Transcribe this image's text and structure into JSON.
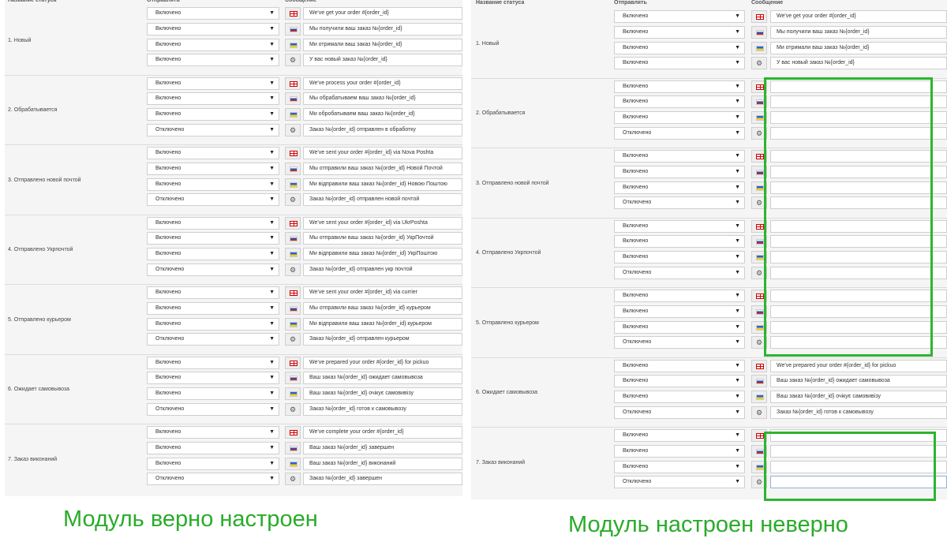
{
  "headers": {
    "status": "Название статуса",
    "send": "Отправлять",
    "message": "Сообщение"
  },
  "options": {
    "on": "Включено",
    "off": "Отключено"
  },
  "statuses": [
    {
      "name": "1. Новый",
      "send": [
        "Включено",
        "Включено",
        "Включено",
        "Включено"
      ],
      "messages": [
        "We've get your order #{order_id}",
        "Мы получили ваш заказ №{order_id}",
        "Ми отримали ваш заказ №{order_id}",
        "У вас новый заказ №{order_id}"
      ]
    },
    {
      "name": "2. Обрабатывается",
      "send": [
        "Включено",
        "Включено",
        "Включено",
        "Отключено"
      ],
      "messages": [
        "We've process your order #{order_id}",
        "Мы обрабатываем ваш заказ №{order_id}",
        "Ми обробатываем ваш заказ №{order_id}",
        "Заказ №{order_id} отправлен в обработку"
      ]
    },
    {
      "name": "3. Отправлено новой почтой",
      "send": [
        "Включено",
        "Включено",
        "Включено",
        "Отключено"
      ],
      "messages": [
        "We've sent your order #{order_id} via Nova Poshta",
        "Мы отправили ваш заказ №{order_id} Новой Почтой",
        "Ми відправили ваш заказ №{order_id} Новою Поштою",
        "Заказ №{order_id} отправлен новой почтой"
      ]
    },
    {
      "name": "4. Отправлено Укрпочтой",
      "send": [
        "Включено",
        "Включено",
        "Включено",
        "Отключено"
      ],
      "messages": [
        "We've sent your order #{order_id} via UkrPoshta",
        "Мы отправили ваш заказ №{order_id} УкрПочтой",
        "Ми відправили ваш заказ №{order_id} УкрПоштою",
        "Заказ №{order_id} отправлен укр почтой"
      ]
    },
    {
      "name": "5. Отправлено курьером",
      "send": [
        "Включено",
        "Включено",
        "Включено",
        "Отключено"
      ],
      "messages": [
        "We've sent your order #{order_id} via currier",
        "Мы отправили ваш заказ №{order_id} курьером",
        "Ми відправили ваш заказ №{order_id} курьером",
        "Заказ №{order_id} отправлен курьером"
      ]
    },
    {
      "name": "6. Ожидает самовывоза",
      "send": [
        "Включено",
        "Включено",
        "Включено",
        "Отключено"
      ],
      "messages": [
        "We've prepared your order #{order_id} for pickuo",
        "Ваш заказ №{order_id} ожидает самовывоза",
        "Ваш заказ №{order_id} очікує самовивізу",
        "Заказ №{order_id} готов к самовывозу"
      ]
    },
    {
      "name": "7. Заказ виконаний",
      "send": [
        "Включено",
        "Включено",
        "Включено",
        "Отключено"
      ],
      "messages": [
        "We've complete your order #{order_id}",
        "Ваш заказ №{order_id} завершен",
        "Ваш заказ №{order_id} виконаний",
        "Заказ №{order_id} завершен"
      ]
    }
  ],
  "right_filled_statuses": [
    0,
    5
  ],
  "captions": {
    "left": "Модуль верно настроен",
    "right": "Модуль настроен неверно"
  },
  "colors": {
    "annotation_green": "#2db52d",
    "caption_green": "#2aab2a"
  }
}
